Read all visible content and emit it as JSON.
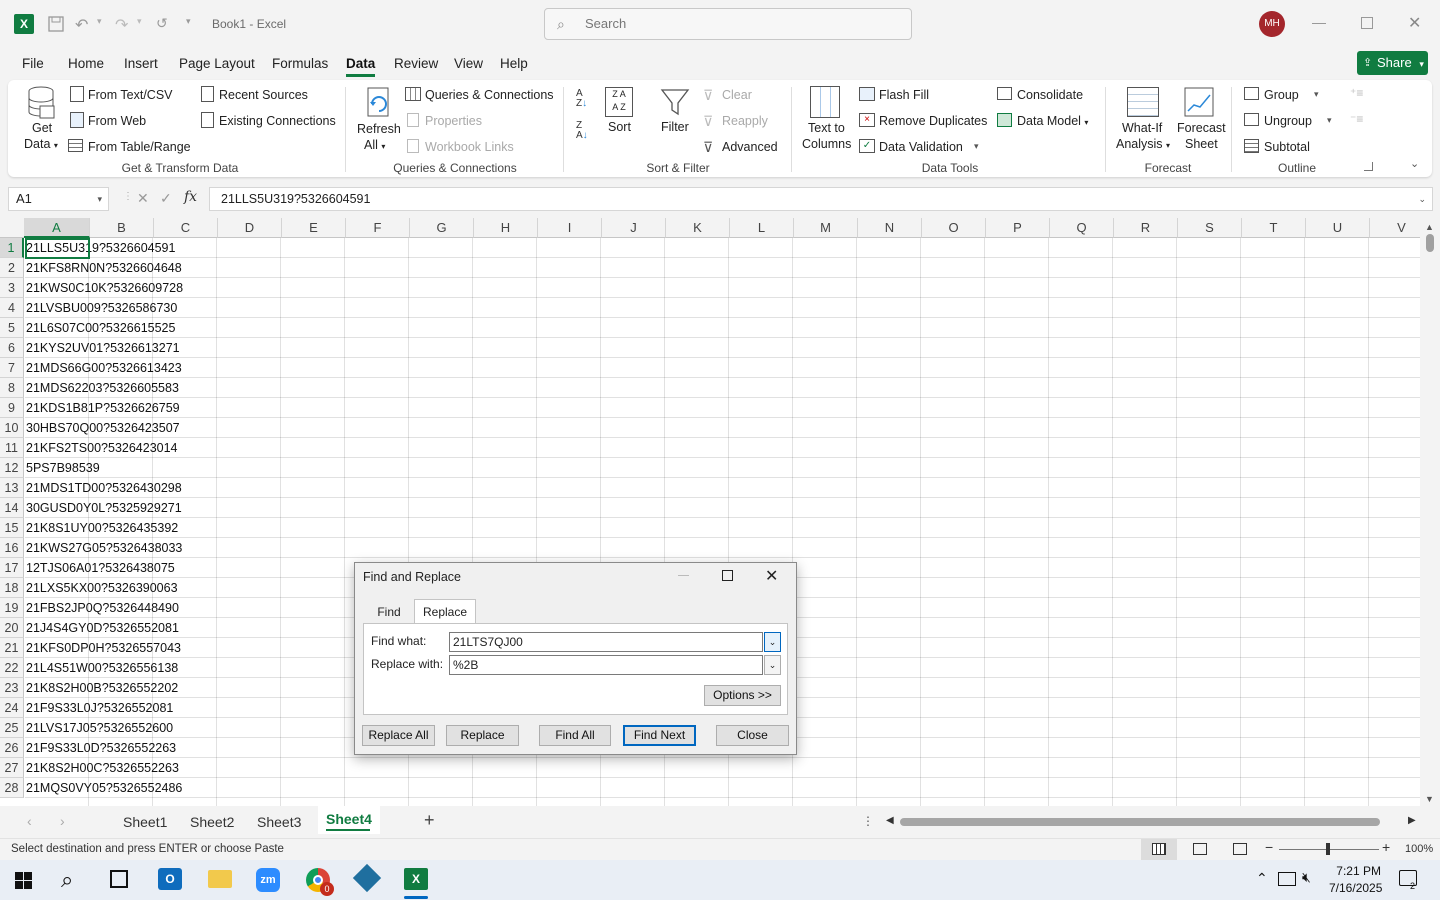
{
  "window": {
    "title": "Book1  -  Excel",
    "search_placeholder": "Search",
    "avatar": "MH"
  },
  "menu": {
    "tabs": [
      "File",
      "Home",
      "Insert",
      "Page Layout",
      "Formulas",
      "Data",
      "Review",
      "View",
      "Help"
    ],
    "active": "Data",
    "share": "Share"
  },
  "ribbon": {
    "get_data": [
      "Get",
      "Data"
    ],
    "from_text_csv": "From Text/CSV",
    "from_web": "From Web",
    "from_table": "From Table/Range",
    "recent_sources": "Recent Sources",
    "existing_connections": "Existing Connections",
    "group_get": "Get & Transform Data",
    "refresh_all": [
      "Refresh",
      "All"
    ],
    "queries_connections": "Queries & Connections",
    "properties": "Properties",
    "workbook_links": "Workbook Links",
    "group_queries": "Queries & Connections",
    "sort": "Sort",
    "filter": "Filter",
    "clear": "Clear",
    "reapply": "Reapply",
    "advanced": "Advanced",
    "group_sort": "Sort & Filter",
    "text_to_columns": [
      "Text to",
      "Columns"
    ],
    "flash_fill": "Flash Fill",
    "remove_duplicates": "Remove Duplicates",
    "data_validation": "Data Validation",
    "consolidate": "Consolidate",
    "data_model": "Data Model",
    "group_data_tools": "Data Tools",
    "what_if": [
      "What-If",
      "Analysis"
    ],
    "forecast_sheet": [
      "Forecast",
      "Sheet"
    ],
    "group_forecast": "Forecast",
    "group_btn": "Group",
    "ungroup": "Ungroup",
    "subtotal": "Subtotal",
    "group_outline": "Outline"
  },
  "formula_bar": {
    "name_box": "A1",
    "fx": "fx",
    "content": "21LLS5U319?5326604591"
  },
  "grid": {
    "columns": [
      "A",
      "B",
      "C",
      "D",
      "E",
      "F",
      "G",
      "H",
      "I",
      "J",
      "K",
      "L",
      "M",
      "N",
      "O",
      "P",
      "Q",
      "R",
      "S",
      "T",
      "U",
      "V"
    ],
    "rows": [
      "1",
      "2",
      "3",
      "4",
      "5",
      "6",
      "7",
      "8",
      "9",
      "10",
      "11",
      "12",
      "13",
      "14",
      "15",
      "16",
      "17",
      "18",
      "19",
      "20",
      "21",
      "22",
      "23",
      "24",
      "25",
      "26",
      "27",
      "28"
    ],
    "values": [
      "21LLS5U319?5326604591",
      "21KFS8RN0N?5326604648",
      "21KWS0C10K?5326609728",
      "21LVSBU009?5326586730",
      "21L6S07C00?5326615525",
      "21KYS2UV01?5326613271",
      "21MDS66G00?5326613423",
      "21MDS62203?5326605583",
      "21KDS1B81P?5326626759",
      "30HBS70Q00?5326423507",
      "21KFS2TS00?5326423014",
      "5PS7B98539",
      "21MDS1TD00?5326430298",
      "30GUSD0Y0L?5325929271",
      "21K8S1UY00?5326435392",
      "21KWS27G05?5326438033",
      "12TJS06A01?5326438075",
      "21LXS5KX00?5326390063",
      "21FBS2JP0Q?5326448490",
      "21J4S4GY0D?5326552081",
      "21KFS0DP0H?5326557043",
      "21L4S51W00?5326556138",
      "21K8S2H00B?5326552202",
      "21F9S33L0J?5326552081",
      "21LVS17J05?5326552600",
      "21F9S33L0D?5326552263",
      "21K8S2H00C?5326552263",
      "21MQS0VY05?5326552486"
    ]
  },
  "dialog": {
    "title": "Find and Replace",
    "tab_find": "Find",
    "tab_replace": "Replace",
    "find_label": "Find what:",
    "find_value": "21LTS7QJ00",
    "replace_label": "Replace with:",
    "replace_value": "%2B",
    "options": "Options >>",
    "replace_all": "Replace All",
    "replace": "Replace",
    "find_all": "Find All",
    "find_next": "Find Next",
    "close": "Close"
  },
  "sheets": {
    "tabs": [
      "Sheet1",
      "Sheet2",
      "Sheet3",
      "Sheet4"
    ],
    "active": "Sheet4"
  },
  "status": {
    "message": "Select destination and press ENTER or choose Paste",
    "zoom": "100%"
  },
  "taskbar": {
    "time": "7:21 PM",
    "date": "7/16/2025",
    "zoom_badge": "0",
    "notif": "2"
  },
  "colors": {
    "excel_green": "#107c41",
    "accent": "#217346"
  }
}
